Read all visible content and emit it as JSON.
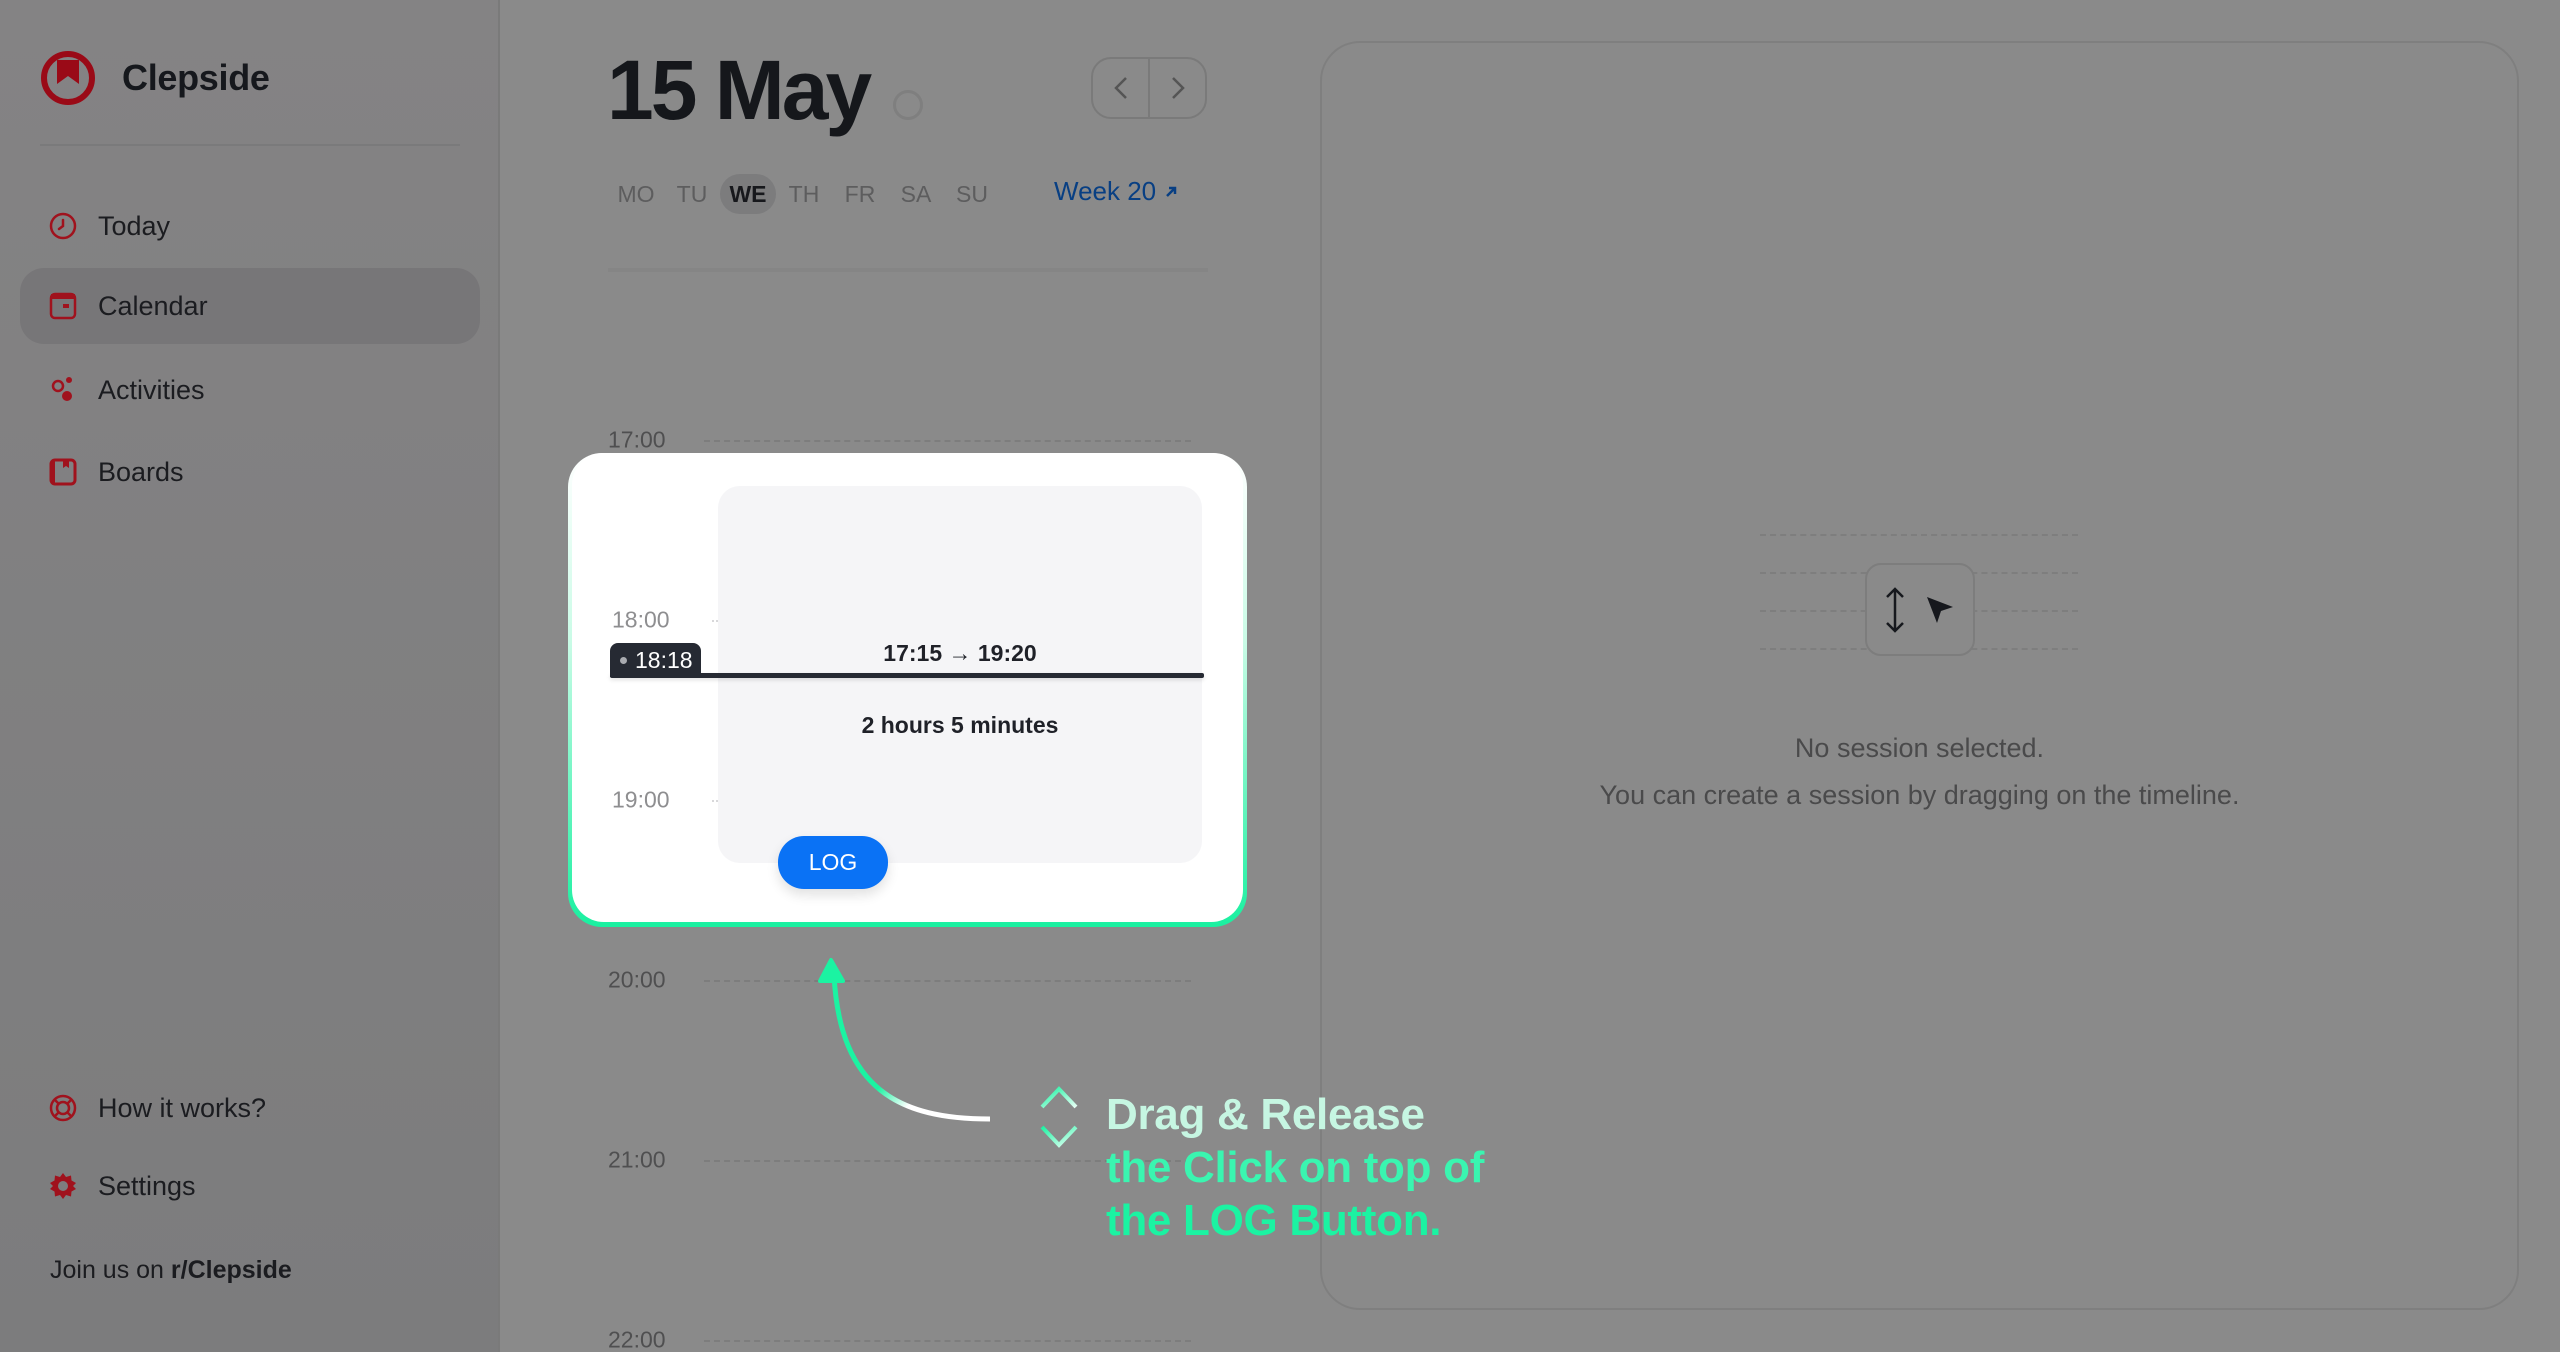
{
  "app": {
    "name": "Clepside",
    "brand_color": "#d0021b"
  },
  "sidebar": {
    "items": [
      {
        "label": "Today",
        "icon": "clock-icon",
        "active": false
      },
      {
        "label": "Calendar",
        "icon": "calendar-icon",
        "active": true
      },
      {
        "label": "Activities",
        "icon": "activities-icon",
        "active": false
      },
      {
        "label": "Boards",
        "icon": "board-icon",
        "active": false
      }
    ],
    "bottom_items": [
      {
        "label": "How it works?",
        "icon": "lifebuoy-icon"
      },
      {
        "label": "Settings",
        "icon": "gear-icon"
      }
    ],
    "footer": {
      "prefix": "Join us on ",
      "link": "r/Clepside"
    }
  },
  "day_view": {
    "title": "15 May",
    "prev_label": "previous day",
    "next_label": "next day",
    "weekdays": [
      "MO",
      "TU",
      "WE",
      "TH",
      "FR",
      "SA",
      "SU"
    ],
    "active_weekday": "WE",
    "week_link": "Week 20",
    "hours": [
      "17:00",
      "18:00",
      "19:00",
      "20:00",
      "21:00",
      "22:00"
    ]
  },
  "session": {
    "start": "17:15",
    "end": "19:20",
    "range_arrow": "→",
    "duration": "2 hours 5 minutes",
    "now_time": "18:18",
    "log_label": "LOG",
    "accent": "#0a72f5"
  },
  "tutorial": {
    "lines": [
      "Drag & Release",
      "the Click on top of",
      "the LOG Button."
    ],
    "accent": "#1bf3a2"
  },
  "detail": {
    "empty_title": "No session selected.",
    "empty_subtitle": "You can create a session by dragging on the timeline."
  }
}
